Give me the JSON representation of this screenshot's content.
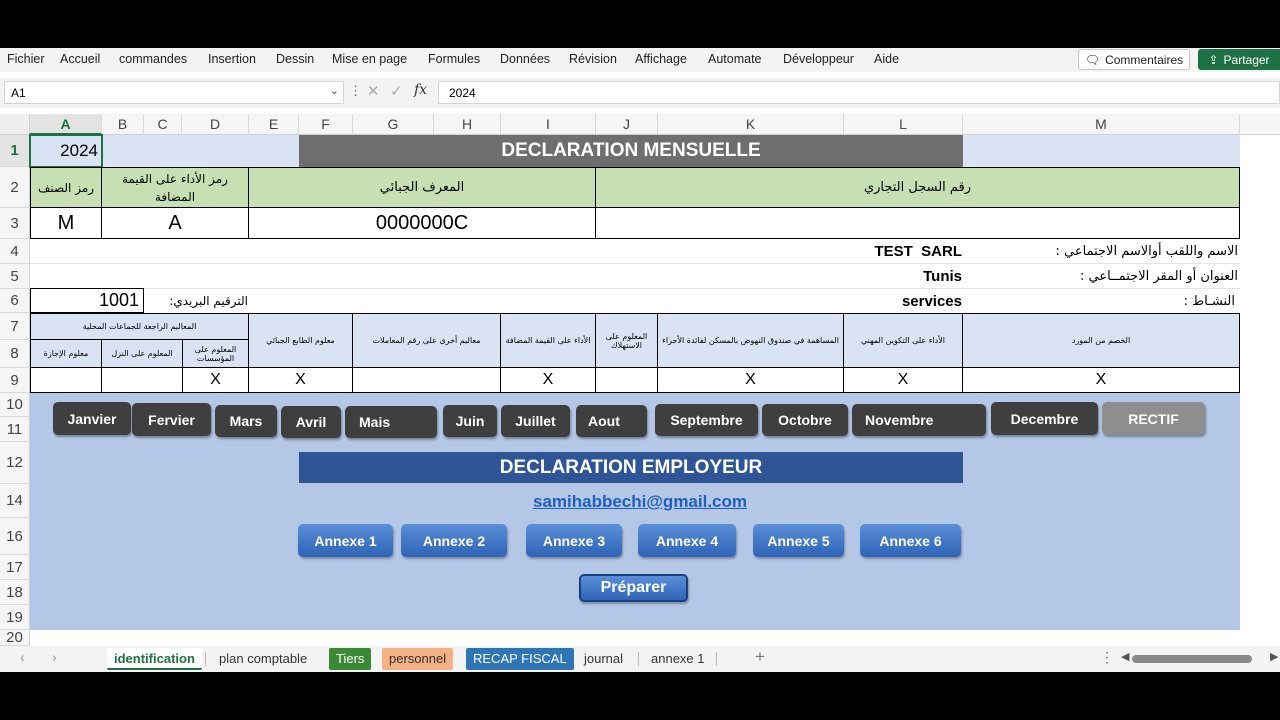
{
  "app": {
    "accent": "#1e7145"
  },
  "menu": {
    "items": [
      "Fichier",
      "Accueil",
      "commandes",
      "Insertion",
      "Dessin",
      "Mise en page",
      "Formules",
      "Données",
      "Révision",
      "Affichage",
      "Automate",
      "Développeur",
      "Aide"
    ],
    "comments_label": "Commentaires",
    "share_label": "Partager"
  },
  "formula_bar": {
    "cell_ref": "A1",
    "fx_label": "fx",
    "value": "2024"
  },
  "columns": [
    "A",
    "B",
    "C",
    "D",
    "E",
    "F",
    "G",
    "H",
    "I",
    "J",
    "K",
    "L",
    "M"
  ],
  "rows": [
    "1",
    "2",
    "3",
    "4",
    "5",
    "6",
    "7",
    "8",
    "9",
    "10",
    "11",
    "12",
    "14",
    "16",
    "17",
    "18",
    "19",
    "20"
  ],
  "sheet": {
    "a1_year": "2024",
    "title": "DECLARATION MENSUELLE",
    "hdr_category_code": "رمز الصنف",
    "hdr_vat_code": "رمز الأداء على القيمة المضافة",
    "hdr_tax_id": "المعرف الجبائي",
    "hdr_commerce_register": "رقم السجل التجاري",
    "category_code": "M",
    "vat_code": "A",
    "tax_id": "0000000C",
    "commerce_register": "",
    "label_name": "الاسم واللقب أوالاسم الاجتماعي :",
    "label_address": "العنوان أو المقر الاجتمــاعي :",
    "label_activity": "النشـاط :",
    "company_name": "TEST  SARL",
    "city": "Tunis",
    "activity": "services",
    "postal_label": "الترقيم البريدي:",
    "postal_code": "1001",
    "taxes": {
      "local_group": "المعاليم الراجعة للجماعات المحلية",
      "rent": "معلوم الإجازة",
      "hotel": "المعلوم على النزل",
      "establishments": "المعلوم على المؤسسات",
      "stamp": "معلوم الطابع الجبائي",
      "other_turnover": "معاليم أخرى على رقم المعاملات",
      "vat": "الأداء على القيمة المضافة",
      "consumption": "المعلوم على الاستهلاك",
      "housing_fund": "المساهمة في صندوق النهوض بالمسكن لفائدة الأجراء",
      "training": "الأداء على التكوين المهني",
      "withholding": "الخصم من المورد"
    },
    "marks": {
      "establishments": "X",
      "stamp": "X",
      "vat": "X",
      "housing_fund": "X",
      "training": "X",
      "withholding": "X"
    }
  },
  "months": [
    "Janvier",
    "Fervier",
    "Mars",
    "Avril",
    "Mais",
    "Juin",
    "Juillet",
    "Aout",
    "Septembre",
    "Octobre",
    "Novembre",
    "Decembre"
  ],
  "rectif_label": "RECTIF",
  "employer": {
    "title": "DECLARATION EMPLOYEUR",
    "email": "samihabbechi@gmail.com",
    "annexes": [
      "Annexe 1",
      "Annexe 2",
      "Annexe 3",
      "Annexe 4",
      "Annexe 5",
      "Annexe 6"
    ],
    "prepare_label": "Préparer"
  },
  "tabs": {
    "sheets": [
      "identification",
      "plan comptable",
      "Tiers",
      "personnel",
      "RECAP FISCAL",
      "journal",
      "annexe 1"
    ],
    "add_label": "+",
    "colors": {
      "Tiers": "#3a8a35",
      "personnel": "#f4b183",
      "RECAP FISCAL": "#2e75b6"
    }
  },
  "colors": {
    "title_gray": "#6e6e6e",
    "header_green": "#c6e0b4",
    "light_blue": "#dae3f3",
    "panel_blue": "#b4c7e7",
    "employer_title": "#2f5597",
    "link_blue": "#1f5fbf"
  }
}
